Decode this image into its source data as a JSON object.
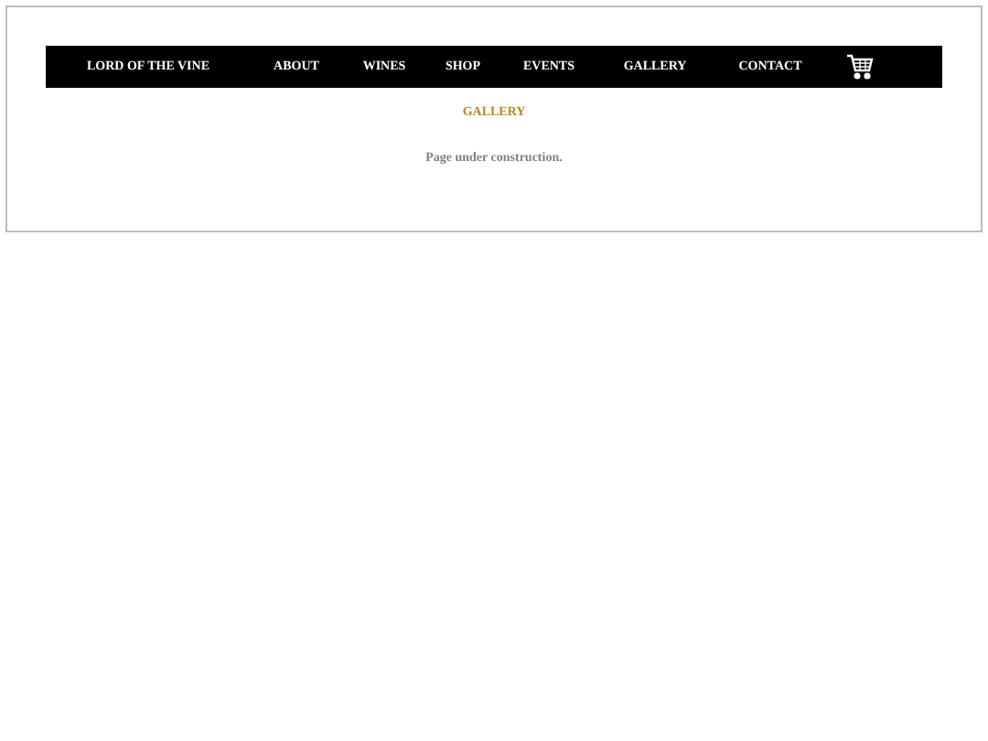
{
  "nav": {
    "logo": "LORD OF THE VINE",
    "items": [
      "ABOUT",
      "WINES",
      "SHOP",
      "EVENTS",
      "GALLERY",
      "CONTACT"
    ]
  },
  "heading": "GALLERY",
  "body": "Page under construction."
}
